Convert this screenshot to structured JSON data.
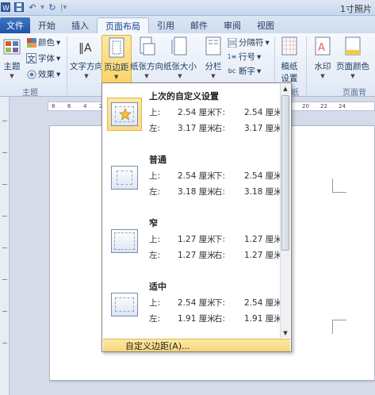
{
  "title_bar": {
    "doc_title": "1寸照片"
  },
  "tabs": [
    {
      "label": "文件"
    },
    {
      "label": "开始"
    },
    {
      "label": "插入"
    },
    {
      "label": "页面布局"
    },
    {
      "label": "引用"
    },
    {
      "label": "邮件"
    },
    {
      "label": "审阅"
    },
    {
      "label": "视图"
    }
  ],
  "ribbon": {
    "theme_group": {
      "themes": "主题",
      "colors": "颜色",
      "fonts": "字体",
      "effects": "效果",
      "label": "主题"
    },
    "page_setup": {
      "text_direction": "文字方向",
      "margins": "页边距",
      "orientation": "纸张方向",
      "size": "纸张大小",
      "columns": "分栏",
      "breaks": "分隔符",
      "line_numbers": "行号",
      "hyphenation": "断字"
    },
    "manuscript": {
      "line1": "稿纸",
      "line2": "设置"
    },
    "paper_label": "纸",
    "watermark": "水印",
    "page_color": "页面颜色",
    "page_background_label": "页面背"
  },
  "ruler": {
    "ticks": [
      "8",
      "6",
      "4",
      "2",
      "20",
      "22",
      "24"
    ]
  },
  "margins_gallery": {
    "items": [
      {
        "title": "上次的自定义设置",
        "top_label": "上:",
        "top": "2.54 厘米",
        "bottom_label": "下:",
        "bottom": "2.54 厘米",
        "left_label": "左:",
        "left": "3.17 厘米",
        "right_label": "右:",
        "right": "3.17 厘米"
      },
      {
        "title": "普通",
        "top_label": "上:",
        "top": "2.54 厘米",
        "bottom_label": "下:",
        "bottom": "2.54 厘米",
        "left_label": "左:",
        "left": "3.18 厘米",
        "right_label": "右:",
        "right": "3.18 厘米"
      },
      {
        "title": "窄",
        "top_label": "上:",
        "top": "1.27 厘米",
        "bottom_label": "下:",
        "bottom": "1.27 厘米",
        "left_label": "左:",
        "left": "1.27 厘米",
        "right_label": "右:",
        "right": "1.27 厘米"
      },
      {
        "title": "适中",
        "top_label": "上:",
        "top": "2.54 厘米",
        "bottom_label": "下:",
        "bottom": "2.54 厘米",
        "left_label": "左:",
        "left": "1.91 厘米",
        "right_label": "右:",
        "right": "1.91 厘米"
      }
    ],
    "custom_margins": "自定义边距(A)..."
  }
}
